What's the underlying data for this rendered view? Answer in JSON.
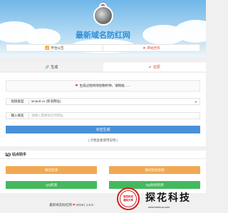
{
  "site_title": "最新域名防红网",
  "notice_bar": {
    "announce_label": "平台公告",
    "cooperate_label": "跨站合作"
  },
  "tabs": {
    "generate": "生成",
    "restore": "还原"
  },
  "status_message": "生成过程将持续数秒钟，请稍候……",
  "form": {
    "type_label": "短链类型",
    "type_value": "sinaurl.cn (新浪网址)",
    "domain_label": "输入域名",
    "domain_placeholder": "请输入需要防红的网址"
  },
  "generate_button": "点击生成",
  "tips_link": "[ 点我查看使用说明 ]",
  "helper": {
    "title": "站点助手",
    "btn1": "微信检测",
    "btn2": "微信防封检测",
    "btn3": "QQ检测",
    "btn4": "QQ防封检测"
  },
  "footer": {
    "prefix": "最新域名防红网",
    "suffix": "2019 | 1.5.0"
  },
  "watermark": {
    "brand": "探花科技",
    "seal_line1": "探花科技",
    "seal_line2": "源码分享",
    "url": "www.tanhua.com"
  },
  "colors": {
    "title": "#2f8fd6",
    "generate_button": "#4a90d9",
    "orange_button": "#f0a952",
    "green_button": "#45b85e",
    "accent_red": "#e03a2a"
  }
}
